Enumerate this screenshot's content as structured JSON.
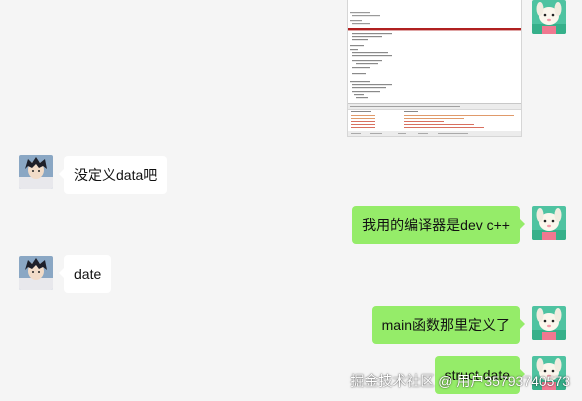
{
  "chat": {
    "messages": [
      {
        "sender": "other",
        "text": "没定义data吧"
      },
      {
        "sender": "self",
        "text": "我用的编译器是dev c++"
      },
      {
        "sender": "other",
        "text": "date"
      },
      {
        "sender": "self",
        "text": "main函数那里定义了"
      },
      {
        "sender": "self",
        "text": "struct date"
      }
    ]
  },
  "colors": {
    "background": "#f5f5f5",
    "self_bubble": "#95ec69",
    "other_bubble": "#ffffff"
  },
  "watermark": "掘金技术社区 @ 用户3579374057​3"
}
